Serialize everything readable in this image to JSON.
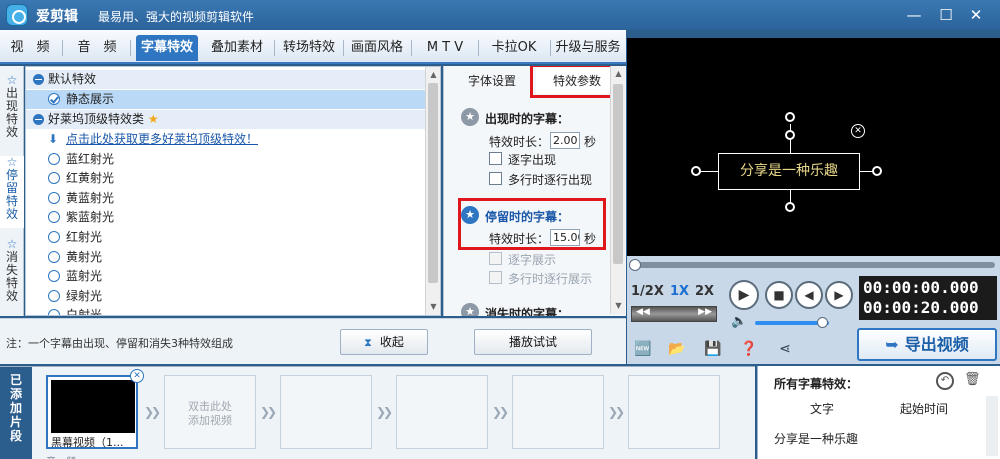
{
  "app": {
    "name": "爱剪辑",
    "slogan": "最易用、强大的视频剪辑软件",
    "window_buttons": [
      "—",
      "☐",
      "✕"
    ]
  },
  "menu": {
    "tabs": [
      "视　频",
      "音　频",
      "字幕特效",
      "叠加素材",
      "转场特效",
      "画面风格",
      "M T V",
      "卡拉OK",
      "升级与服务"
    ],
    "active_index": 2
  },
  "side_tabs": [
    {
      "label": "出现特效",
      "active": false
    },
    {
      "label": "停留特效",
      "active": true
    },
    {
      "label": "消失特效",
      "active": false
    }
  ],
  "effects_list": {
    "group_default": "默认特效",
    "static_item": "静态展示",
    "group_premium": "好莱坞顶级特效类",
    "more_link": "点击此处获取更多好莱坞顶级特效！",
    "items": [
      "蓝红射光",
      "红黄射光",
      "黄蓝射光",
      "紫蓝射光",
      "红射光",
      "黄射光",
      "蓝射光",
      "绿射光",
      "白射光"
    ]
  },
  "info_bar": {
    "note": "注：一个字幕由出现、停留和消失3种特效组成",
    "collapse_button": "收起",
    "play_button": "播放试试"
  },
  "settings": {
    "tab_font": "字体设置",
    "tab_params": "特效参数",
    "appear_title": "出现时的字幕：",
    "duration_label": "特效时长：",
    "appear_duration": "2.00",
    "unit": "秒",
    "char_by_char": "逐字出现",
    "line_by_line": "多行时逐行出现",
    "stay_title": "停留时的字幕：",
    "stay_duration": "15.00",
    "stay_char": "逐字展示",
    "stay_line": "多行时逐行展示",
    "vanish_title": "消失时的字幕："
  },
  "preview": {
    "caption_text": "分享是一种乐趣"
  },
  "player": {
    "speeds": [
      "1/2X",
      "1X",
      "2X"
    ],
    "active_speed": "1X",
    "current_time": "00:00:00.000",
    "total_time": "00:00:20.000",
    "export_button": "导出视频",
    "volume_level": 0.92,
    "progress": 0
  },
  "timeline": {
    "label": "已添加片段",
    "first_clip_name": "黑幕视频（1...",
    "placeholder_hint_line1": "双击此处",
    "placeholder_hint_line2": "添加视频",
    "audio_label": "音　频"
  },
  "fx_panel": {
    "title": "所有字幕特效：",
    "col_text": "文字",
    "col_time": "起始时间",
    "row_text": "分享是一种乐趣"
  },
  "colors": {
    "accent": "#2e76c2",
    "highlight_red": "#e0161d",
    "caption_gold": "#e8d88a"
  }
}
